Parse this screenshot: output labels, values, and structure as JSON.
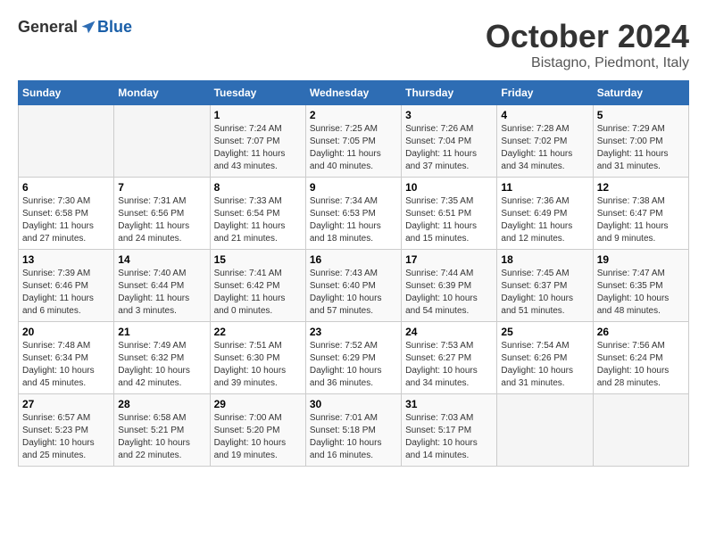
{
  "header": {
    "logo_general": "General",
    "logo_blue": "Blue",
    "month": "October 2024",
    "location": "Bistagno, Piedmont, Italy"
  },
  "weekdays": [
    "Sunday",
    "Monday",
    "Tuesday",
    "Wednesday",
    "Thursday",
    "Friday",
    "Saturday"
  ],
  "weeks": [
    [
      {
        "day": "",
        "sunrise": "",
        "sunset": "",
        "daylight": ""
      },
      {
        "day": "",
        "sunrise": "",
        "sunset": "",
        "daylight": ""
      },
      {
        "day": "1",
        "sunrise": "Sunrise: 7:24 AM",
        "sunset": "Sunset: 7:07 PM",
        "daylight": "Daylight: 11 hours and 43 minutes."
      },
      {
        "day": "2",
        "sunrise": "Sunrise: 7:25 AM",
        "sunset": "Sunset: 7:05 PM",
        "daylight": "Daylight: 11 hours and 40 minutes."
      },
      {
        "day": "3",
        "sunrise": "Sunrise: 7:26 AM",
        "sunset": "Sunset: 7:04 PM",
        "daylight": "Daylight: 11 hours and 37 minutes."
      },
      {
        "day": "4",
        "sunrise": "Sunrise: 7:28 AM",
        "sunset": "Sunset: 7:02 PM",
        "daylight": "Daylight: 11 hours and 34 minutes."
      },
      {
        "day": "5",
        "sunrise": "Sunrise: 7:29 AM",
        "sunset": "Sunset: 7:00 PM",
        "daylight": "Daylight: 11 hours and 31 minutes."
      }
    ],
    [
      {
        "day": "6",
        "sunrise": "Sunrise: 7:30 AM",
        "sunset": "Sunset: 6:58 PM",
        "daylight": "Daylight: 11 hours and 27 minutes."
      },
      {
        "day": "7",
        "sunrise": "Sunrise: 7:31 AM",
        "sunset": "Sunset: 6:56 PM",
        "daylight": "Daylight: 11 hours and 24 minutes."
      },
      {
        "day": "8",
        "sunrise": "Sunrise: 7:33 AM",
        "sunset": "Sunset: 6:54 PM",
        "daylight": "Daylight: 11 hours and 21 minutes."
      },
      {
        "day": "9",
        "sunrise": "Sunrise: 7:34 AM",
        "sunset": "Sunset: 6:53 PM",
        "daylight": "Daylight: 11 hours and 18 minutes."
      },
      {
        "day": "10",
        "sunrise": "Sunrise: 7:35 AM",
        "sunset": "Sunset: 6:51 PM",
        "daylight": "Daylight: 11 hours and 15 minutes."
      },
      {
        "day": "11",
        "sunrise": "Sunrise: 7:36 AM",
        "sunset": "Sunset: 6:49 PM",
        "daylight": "Daylight: 11 hours and 12 minutes."
      },
      {
        "day": "12",
        "sunrise": "Sunrise: 7:38 AM",
        "sunset": "Sunset: 6:47 PM",
        "daylight": "Daylight: 11 hours and 9 minutes."
      }
    ],
    [
      {
        "day": "13",
        "sunrise": "Sunrise: 7:39 AM",
        "sunset": "Sunset: 6:46 PM",
        "daylight": "Daylight: 11 hours and 6 minutes."
      },
      {
        "day": "14",
        "sunrise": "Sunrise: 7:40 AM",
        "sunset": "Sunset: 6:44 PM",
        "daylight": "Daylight: 11 hours and 3 minutes."
      },
      {
        "day": "15",
        "sunrise": "Sunrise: 7:41 AM",
        "sunset": "Sunset: 6:42 PM",
        "daylight": "Daylight: 11 hours and 0 minutes."
      },
      {
        "day": "16",
        "sunrise": "Sunrise: 7:43 AM",
        "sunset": "Sunset: 6:40 PM",
        "daylight": "Daylight: 10 hours and 57 minutes."
      },
      {
        "day": "17",
        "sunrise": "Sunrise: 7:44 AM",
        "sunset": "Sunset: 6:39 PM",
        "daylight": "Daylight: 10 hours and 54 minutes."
      },
      {
        "day": "18",
        "sunrise": "Sunrise: 7:45 AM",
        "sunset": "Sunset: 6:37 PM",
        "daylight": "Daylight: 10 hours and 51 minutes."
      },
      {
        "day": "19",
        "sunrise": "Sunrise: 7:47 AM",
        "sunset": "Sunset: 6:35 PM",
        "daylight": "Daylight: 10 hours and 48 minutes."
      }
    ],
    [
      {
        "day": "20",
        "sunrise": "Sunrise: 7:48 AM",
        "sunset": "Sunset: 6:34 PM",
        "daylight": "Daylight: 10 hours and 45 minutes."
      },
      {
        "day": "21",
        "sunrise": "Sunrise: 7:49 AM",
        "sunset": "Sunset: 6:32 PM",
        "daylight": "Daylight: 10 hours and 42 minutes."
      },
      {
        "day": "22",
        "sunrise": "Sunrise: 7:51 AM",
        "sunset": "Sunset: 6:30 PM",
        "daylight": "Daylight: 10 hours and 39 minutes."
      },
      {
        "day": "23",
        "sunrise": "Sunrise: 7:52 AM",
        "sunset": "Sunset: 6:29 PM",
        "daylight": "Daylight: 10 hours and 36 minutes."
      },
      {
        "day": "24",
        "sunrise": "Sunrise: 7:53 AM",
        "sunset": "Sunset: 6:27 PM",
        "daylight": "Daylight: 10 hours and 34 minutes."
      },
      {
        "day": "25",
        "sunrise": "Sunrise: 7:54 AM",
        "sunset": "Sunset: 6:26 PM",
        "daylight": "Daylight: 10 hours and 31 minutes."
      },
      {
        "day": "26",
        "sunrise": "Sunrise: 7:56 AM",
        "sunset": "Sunset: 6:24 PM",
        "daylight": "Daylight: 10 hours and 28 minutes."
      }
    ],
    [
      {
        "day": "27",
        "sunrise": "Sunrise: 6:57 AM",
        "sunset": "Sunset: 5:23 PM",
        "daylight": "Daylight: 10 hours and 25 minutes."
      },
      {
        "day": "28",
        "sunrise": "Sunrise: 6:58 AM",
        "sunset": "Sunset: 5:21 PM",
        "daylight": "Daylight: 10 hours and 22 minutes."
      },
      {
        "day": "29",
        "sunrise": "Sunrise: 7:00 AM",
        "sunset": "Sunset: 5:20 PM",
        "daylight": "Daylight: 10 hours and 19 minutes."
      },
      {
        "day": "30",
        "sunrise": "Sunrise: 7:01 AM",
        "sunset": "Sunset: 5:18 PM",
        "daylight": "Daylight: 10 hours and 16 minutes."
      },
      {
        "day": "31",
        "sunrise": "Sunrise: 7:03 AM",
        "sunset": "Sunset: 5:17 PM",
        "daylight": "Daylight: 10 hours and 14 minutes."
      },
      {
        "day": "",
        "sunrise": "",
        "sunset": "",
        "daylight": ""
      },
      {
        "day": "",
        "sunrise": "",
        "sunset": "",
        "daylight": ""
      }
    ]
  ]
}
